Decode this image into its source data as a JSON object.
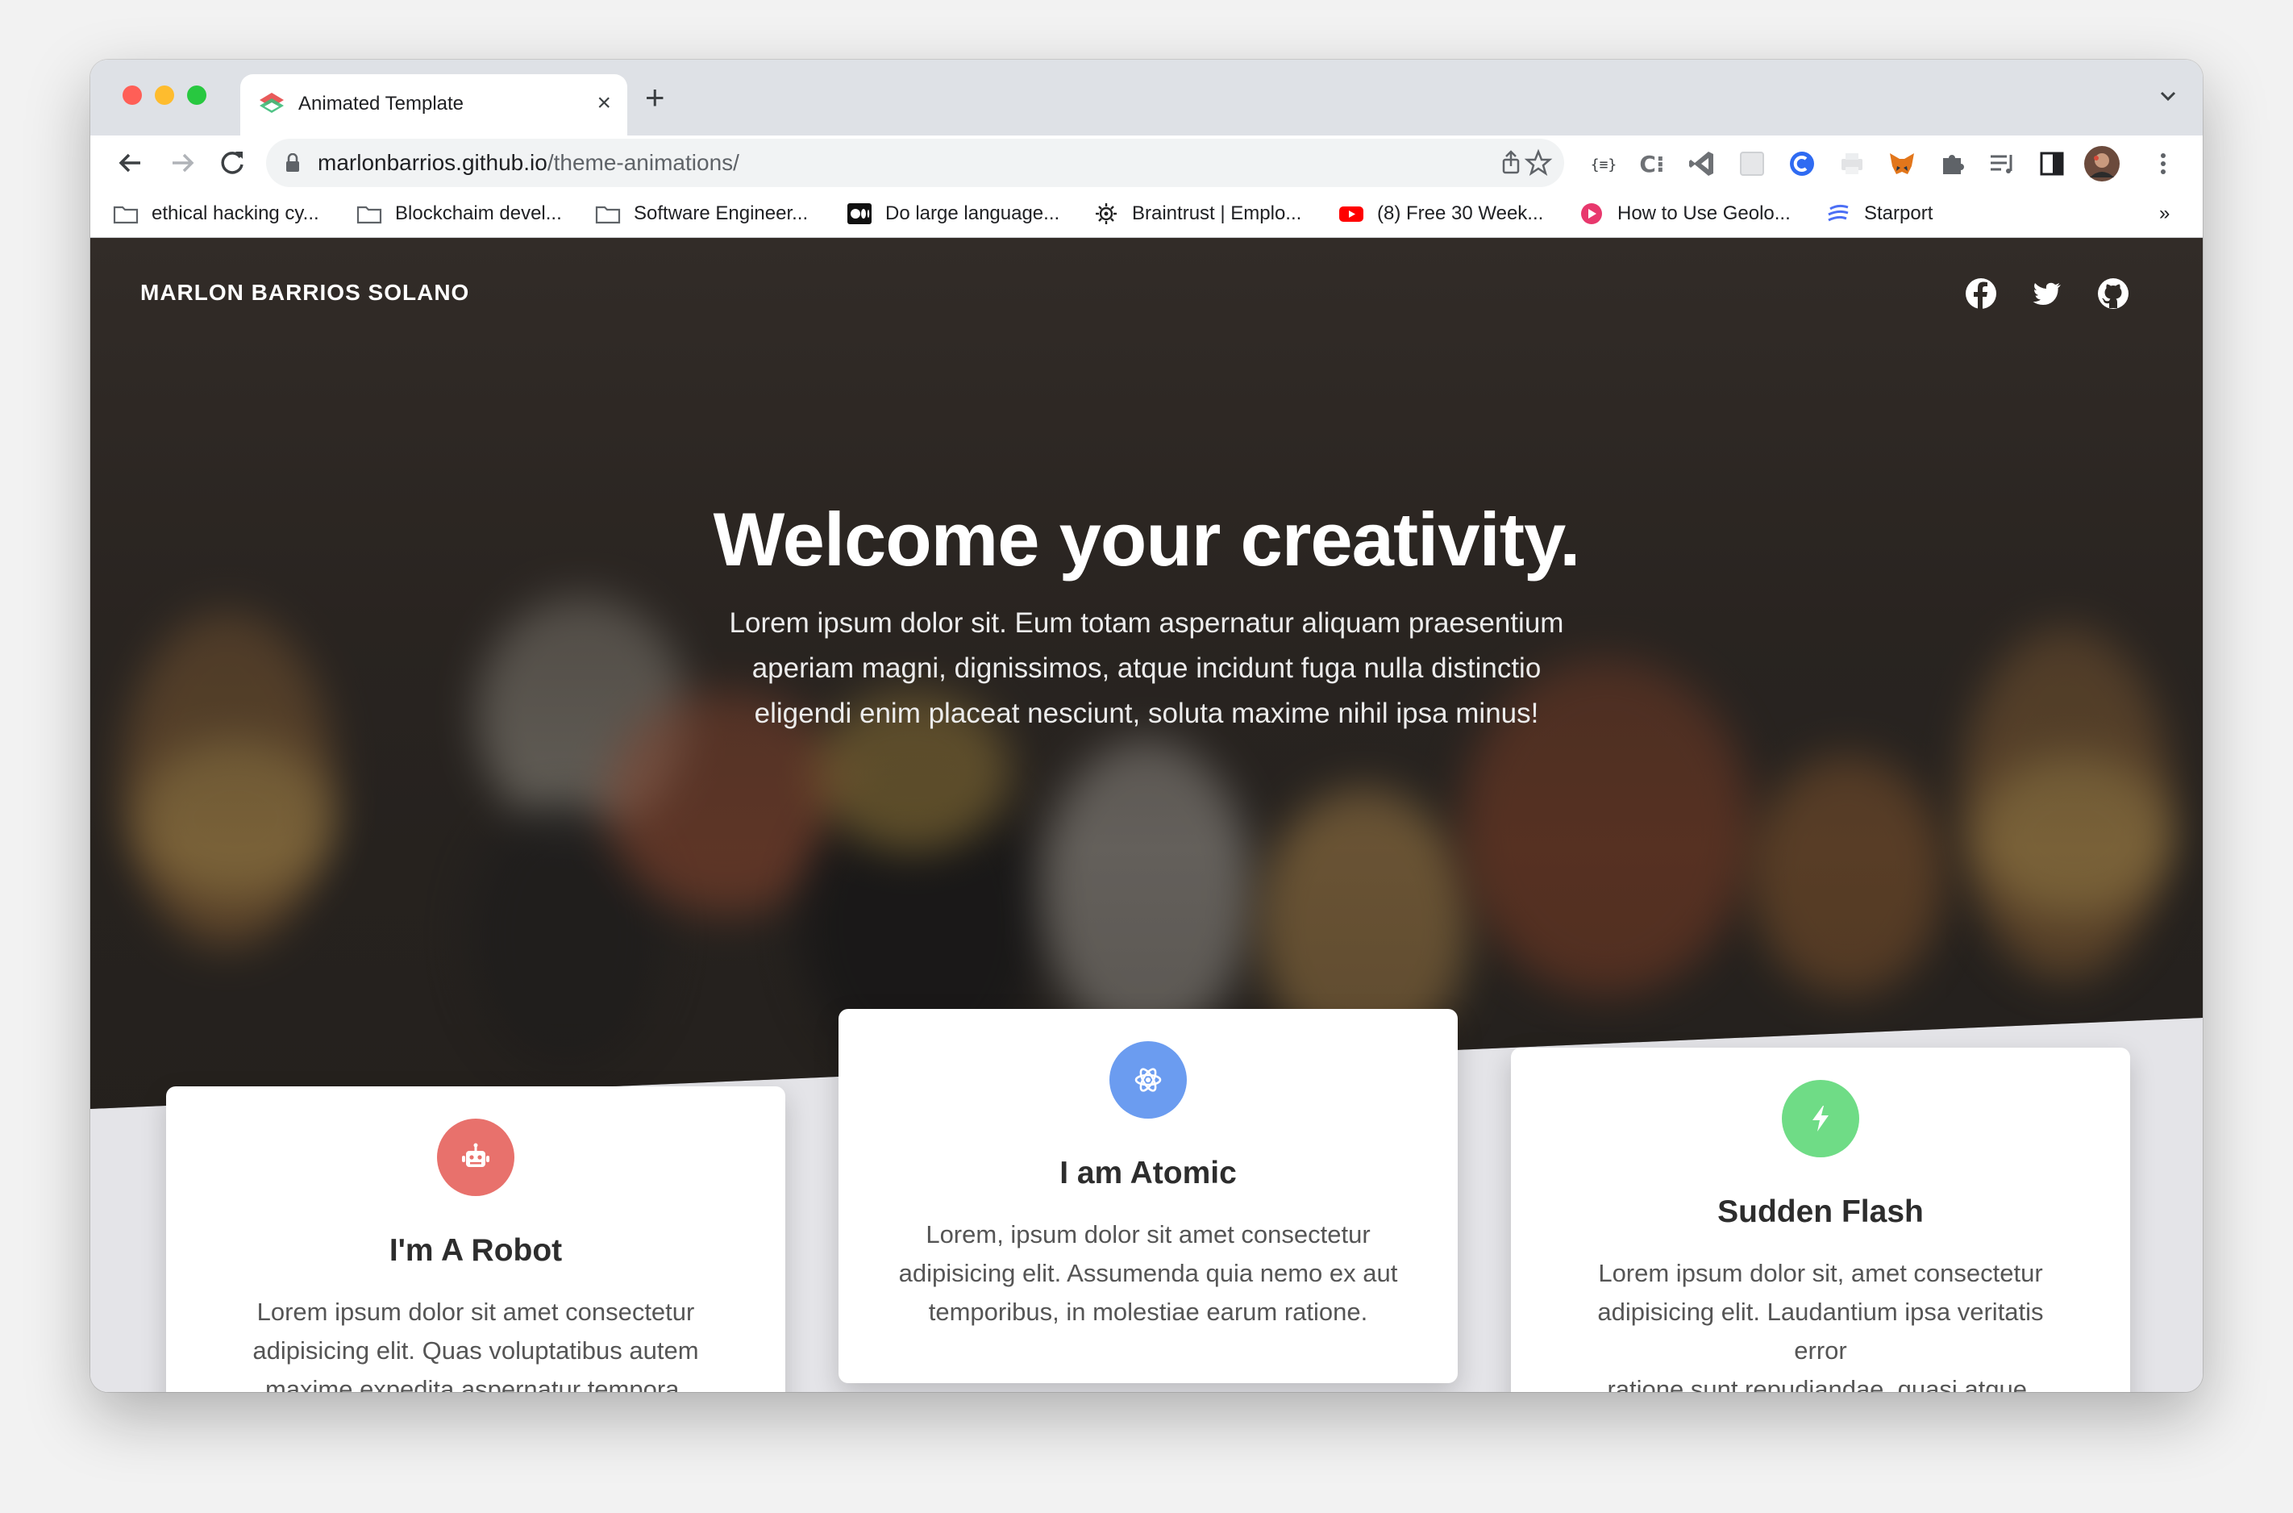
{
  "browser": {
    "tab_title": "Animated Template",
    "tab_close": "×",
    "new_tab": "+",
    "url_host": "marlonbarrios.github.io",
    "url_path": "/theme-animations/",
    "bookmarks": [
      {
        "label": "ethical hacking cy...",
        "icon": "folder-icon"
      },
      {
        "label": "Blockchaim devel...",
        "icon": "folder-icon"
      },
      {
        "label": "Software Engineer...",
        "icon": "folder-icon"
      },
      {
        "label": "Do large language...",
        "icon": "medium-icon"
      },
      {
        "label": "Braintrust | Emplo...",
        "icon": "gear-icon"
      },
      {
        "label": "(8) Free 30 Week...",
        "icon": "youtube-icon"
      },
      {
        "label": "How to Use Geolo...",
        "icon": "bookmark-site-icon"
      },
      {
        "label": "Starport",
        "icon": "starport-icon"
      }
    ],
    "bookmarks_overflow": "»"
  },
  "page": {
    "brand": "MARLON BARRIOS SOLANO",
    "social": [
      "facebook-icon",
      "twitter-icon",
      "github-icon"
    ],
    "hero_title": "Welcome your creativity.",
    "hero_lines": [
      "Lorem ipsum dolor sit. Eum totam aspernatur aliquam praesentium",
      "aperiam magni, dignissimos, atque incidunt fuga nulla distinctio",
      "eligendi enim placeat nesciunt, soluta maxime nihil ipsa minus!"
    ],
    "cards": [
      {
        "title": "I'm A Robot",
        "icon": "robot-icon",
        "color": "#e8716c",
        "lines": [
          "Lorem ipsum dolor sit amet consectetur",
          "adipisicing elit. Quas voluptatibus autem",
          "maxime expedita aspernatur tempora."
        ]
      },
      {
        "title": "I am Atomic",
        "icon": "atom-icon",
        "color": "#6b9cf0",
        "lines": [
          "Lorem, ipsum dolor sit amet consectetur",
          "adipisicing elit. Assumenda quia nemo ex aut",
          "temporibus, in molestiae earum ratione."
        ]
      },
      {
        "title": "Sudden Flash",
        "icon": "bolt-icon",
        "color": "#6fdc86",
        "lines": [
          "Lorem ipsum dolor sit, amet consectetur",
          "adipisicing elit. Laudantium ipsa veritatis error",
          "ratione sunt repudiandae, quasi atque."
        ]
      }
    ]
  }
}
